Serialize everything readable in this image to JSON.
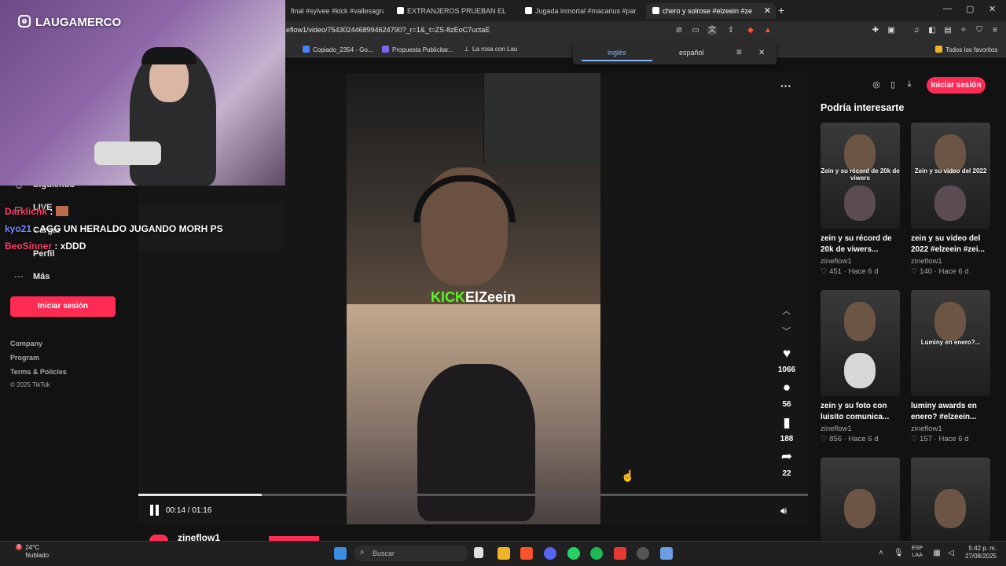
{
  "browser": {
    "tabs": [
      {
        "label": "final #sylvee #kick #vallesagradorp",
        "active": false
      },
      {
        "label": "EXTRANJEROS PRUEBAN EL PAN CON",
        "active": false
      },
      {
        "label": "Jugada inmortal #macarius #paratil",
        "active": false
      },
      {
        "label": "chero y solrose #elzeein #ze",
        "active": true
      }
    ],
    "url": "eflow1/video/7543024468994624790?_r=1&_t=ZS-8zEoC7uctaE",
    "bookmarks": [
      {
        "label": "Copiado_2354 - Go...",
        "color": "#4285f4"
      },
      {
        "label": "Propuesta Publicitar...",
        "color": "#7b68ee"
      },
      {
        "label": "La rosa con Lau",
        "color": "#dddddd"
      }
    ],
    "all_bookmarks": "Todos los favoritos",
    "translate": {
      "source": "inglés",
      "target": "español"
    }
  },
  "sidebar": {
    "items": [
      "Siguiendo",
      "LIVE",
      "Cargar",
      "Perfil",
      "Más"
    ],
    "login_button": "Iniciar sesión",
    "footer": [
      "Company",
      "Program",
      "Terms & Policies",
      "© 2025 TikTok"
    ]
  },
  "player": {
    "overlay_brand": "KICK",
    "overlay_name": "ElZeein",
    "time": "00:14 / 01:16",
    "progress": 0.1842,
    "actions": [
      {
        "icon": "heart-icon",
        "glyph": "♥",
        "count": "1066"
      },
      {
        "icon": "comment-icon",
        "glyph": "●",
        "count": "56"
      },
      {
        "icon": "bookmark-icon",
        "glyph": "▮",
        "count": "188"
      },
      {
        "icon": "share-icon",
        "glyph": "➦",
        "count": "22"
      }
    ],
    "author": "zineflow1"
  },
  "right": {
    "login_button": "Iniciar sesión",
    "title": "Podría interesarte",
    "cards": [
      {
        "overlay": "Zein y su récord de 20k de viwers",
        "title": "zein y su récord de 20k de viwers...",
        "author": "zineflow1",
        "likes": "451",
        "age": "Hace 6 d"
      },
      {
        "overlay": "Zein y su video del 2022",
        "title": "zein y su video del 2022 #elzeein #zei...",
        "author": "zineflow1",
        "likes": "140",
        "age": "Hace 6 d"
      },
      {
        "overlay": "",
        "title": "zein y su foto con luisito comunica...",
        "author": "zineflow1",
        "likes": "856",
        "age": "Hace 6 d"
      },
      {
        "overlay": "Luminy en enero?...",
        "title": "luminy awards en enero? #elzeein...",
        "author": "zineflow1",
        "likes": "157",
        "age": "Hace 6 d"
      },
      {
        "overlay": "",
        "title": "",
        "author": "",
        "likes": "",
        "age": ""
      },
      {
        "overlay": "",
        "title": "",
        "author": "",
        "likes": "",
        "age": ""
      }
    ]
  },
  "stream": {
    "handle": "LAUGAMERCO",
    "chat": [
      {
        "user": "Darklichk",
        "color": "#ff3d6b",
        "message": ""
      },
      {
        "user": "kyo21",
        "color": "#7b86ff",
        "message": "AGG UN HERALDO JUGANDO MORH PS"
      },
      {
        "user": "BeoSinner",
        "color": "#ff3d6b",
        "message": "xDDD"
      }
    ]
  },
  "taskbar": {
    "weather_temp": "24°C",
    "weather_desc": "Nublado",
    "weather_badge": "5",
    "search_placeholder": "Buscar",
    "lang_top": "ESP",
    "lang_bottom": "LAA",
    "time": "5:42 p. m.",
    "date": "27/08/2025"
  },
  "colors": {
    "accent": "#fe2c55",
    "kick_green": "#53fc18"
  }
}
